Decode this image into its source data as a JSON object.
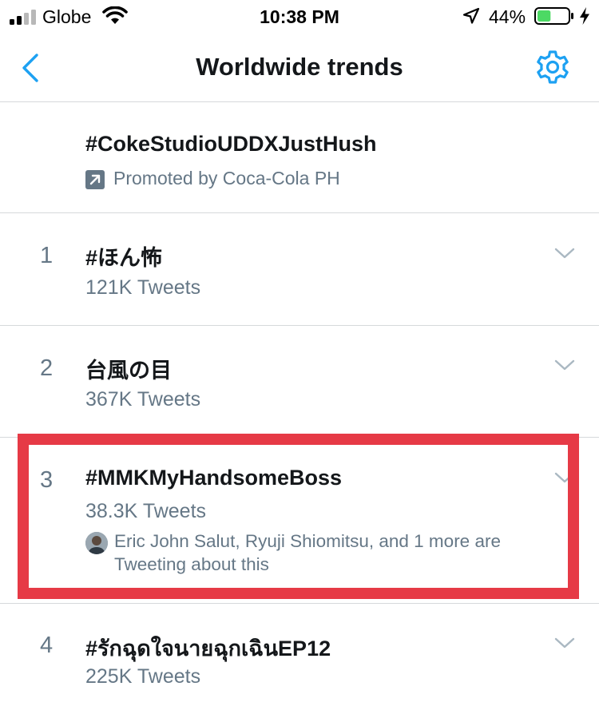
{
  "status_bar": {
    "carrier": "Globe",
    "time": "10:38 PM",
    "battery_percent": "44%",
    "battery_level": 0.44,
    "battery_color": "#4cd964"
  },
  "nav": {
    "title": "Worldwide trends",
    "back_icon": "chevron-left-icon",
    "settings_icon": "gear-icon",
    "accent_color": "#1da1f2"
  },
  "promoted": {
    "name": "#CokeStudioUDDXJustHush",
    "label": "Promoted by Coca-Cola PH",
    "icon": "promoted-arrow-icon"
  },
  "trends": [
    {
      "rank": "1",
      "name": "#ほん怖",
      "count": "121K Tweets"
    },
    {
      "rank": "2",
      "name": "台風の目",
      "count": "367K Tweets"
    },
    {
      "rank": "3",
      "name": "#MMKMyHandsomeBoss",
      "count": "38.3K Tweets",
      "social_context": "Eric John Salut, Ryuji Shiomitsu, and 1 more are Tweeting about this"
    },
    {
      "rank": "4",
      "name": "#รักฉุดใจนายฉุกเฉินEP12",
      "count": "225K Tweets"
    }
  ],
  "highlight_color": "#e63a46"
}
